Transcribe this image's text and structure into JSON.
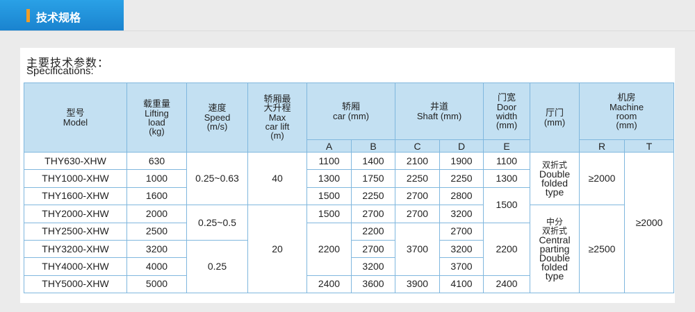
{
  "tab": {
    "label": "技术规格"
  },
  "title": {
    "cn": "主要技术参数：",
    "en": "Specifications:"
  },
  "table": {
    "headers": {
      "model": {
        "cn": "型号",
        "en": "Model"
      },
      "load": {
        "cn": "载重量",
        "en1": "Lifting",
        "en2": "load",
        "en3": "(kg)"
      },
      "speed": {
        "cn": "速度",
        "en1": "Speed",
        "en2": "(m/s)"
      },
      "lift": {
        "cn1": "轿厢最",
        "cn2": "大升程",
        "en1": "Max",
        "en2": "car lift",
        "en3": "(m)"
      },
      "car": {
        "cn": "轿厢",
        "en": "car (mm)"
      },
      "shaft": {
        "cn": "井道",
        "en": "Shaft (mm)"
      },
      "door_width": {
        "cn": "门宽",
        "en1": "Door",
        "en2": "width",
        "en3": "(mm)"
      },
      "landing_door": {
        "cn": "厅门",
        "en": "(mm)"
      },
      "machine_room": {
        "cn": "机房",
        "en1": "Machine",
        "en2": "room",
        "en3": "(mm)"
      },
      "sub": {
        "A": "A",
        "B": "B",
        "C": "C",
        "D": "D",
        "E": "E",
        "R": "R",
        "T": "T"
      }
    },
    "rows": [
      {
        "model": "THY630-XHW",
        "load": "630"
      },
      {
        "model": "THY1000-XHW",
        "load": "1000"
      },
      {
        "model": "THY1600-XHW",
        "load": "1600"
      },
      {
        "model": "THY2000-XHW",
        "load": "2000"
      },
      {
        "model": "THY2500-XHW",
        "load": "2500"
      },
      {
        "model": "THY3200-XHW",
        "load": "3200"
      },
      {
        "model": "THY4000-XHW",
        "load": "4000"
      },
      {
        "model": "THY5000-XHW",
        "load": "5000"
      }
    ],
    "speed_groups": [
      "0.25~0.63",
      "0.25~0.5",
      "0.25"
    ],
    "lift_groups": [
      "40",
      "20"
    ],
    "car_a": [
      "1100",
      "1300",
      "1500",
      "1500",
      "2200",
      "2400"
    ],
    "car_b": [
      "1400",
      "1750",
      "2250",
      "2700",
      "2200",
      "2700",
      "3200",
      "3600"
    ],
    "shaft_c": [
      "2100",
      "2250",
      "2700",
      "2700",
      "3700",
      "3900"
    ],
    "shaft_d": [
      "1900",
      "2250",
      "2800",
      "3200",
      "2700",
      "3200",
      "3700",
      "4100"
    ],
    "door_e": [
      "1100",
      "1300",
      "1500",
      "2200",
      "2400"
    ],
    "door_type_1": {
      "cn": "双折式",
      "en1": "Double",
      "en2": "folded",
      "en3": "type"
    },
    "door_type_2": {
      "cn1": "中分",
      "cn2": "双折式",
      "en1": "Central",
      "en2": "parting",
      "en3": "Double",
      "en4": "folded",
      "en5": "type"
    },
    "r_groups": [
      "≥2000",
      "≥2500"
    ],
    "t_value": "≥2000"
  }
}
